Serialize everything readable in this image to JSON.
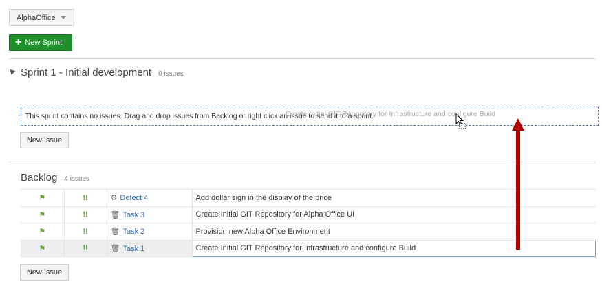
{
  "project_selector": {
    "label": "AlphaOffice"
  },
  "toolbar": {
    "new_sprint_label": "New Sprint"
  },
  "sprint": {
    "title": "Sprint 1 - Initial development",
    "count": "0 issues",
    "empty_message": "This sprint contains no issues. Drag and drop issues from Backlog or right click an issue to send it to a sprint.",
    "drag_ghost_text": "Create Initial GIT Repository for Infrastructure and configure Build",
    "new_issue_label": "New Issue"
  },
  "backlog": {
    "title": "Backlog",
    "count": "4 issues",
    "new_issue_label": "New Issue",
    "rows": [
      {
        "priority_icon": "flag-icon",
        "severity": "!!",
        "type_icon": "bug-icon",
        "key": "Defect 4",
        "summary": "Add dollar sign in the display of the price"
      },
      {
        "priority_icon": "flag-icon",
        "severity": "!!",
        "type_icon": "task-icon",
        "key": "Task 3",
        "summary": "Create Initial GIT Repository for Alpha Office UI"
      },
      {
        "priority_icon": "flag-icon",
        "severity": "!!",
        "type_icon": "task-icon",
        "key": "Task 2",
        "summary": "Provision new Alpha Office Environment"
      },
      {
        "priority_icon": "flag-icon",
        "severity": "!!",
        "type_icon": "task-icon",
        "key": "Task 1",
        "summary": "Create Initial GIT Repository for Infrastructure and configure Build"
      }
    ]
  },
  "colors": {
    "accent_green": "#1e8f2a",
    "link_blue": "#2f6eb5",
    "drop_border": "#3b7fc4",
    "annotation_arrow": "#b00000"
  }
}
